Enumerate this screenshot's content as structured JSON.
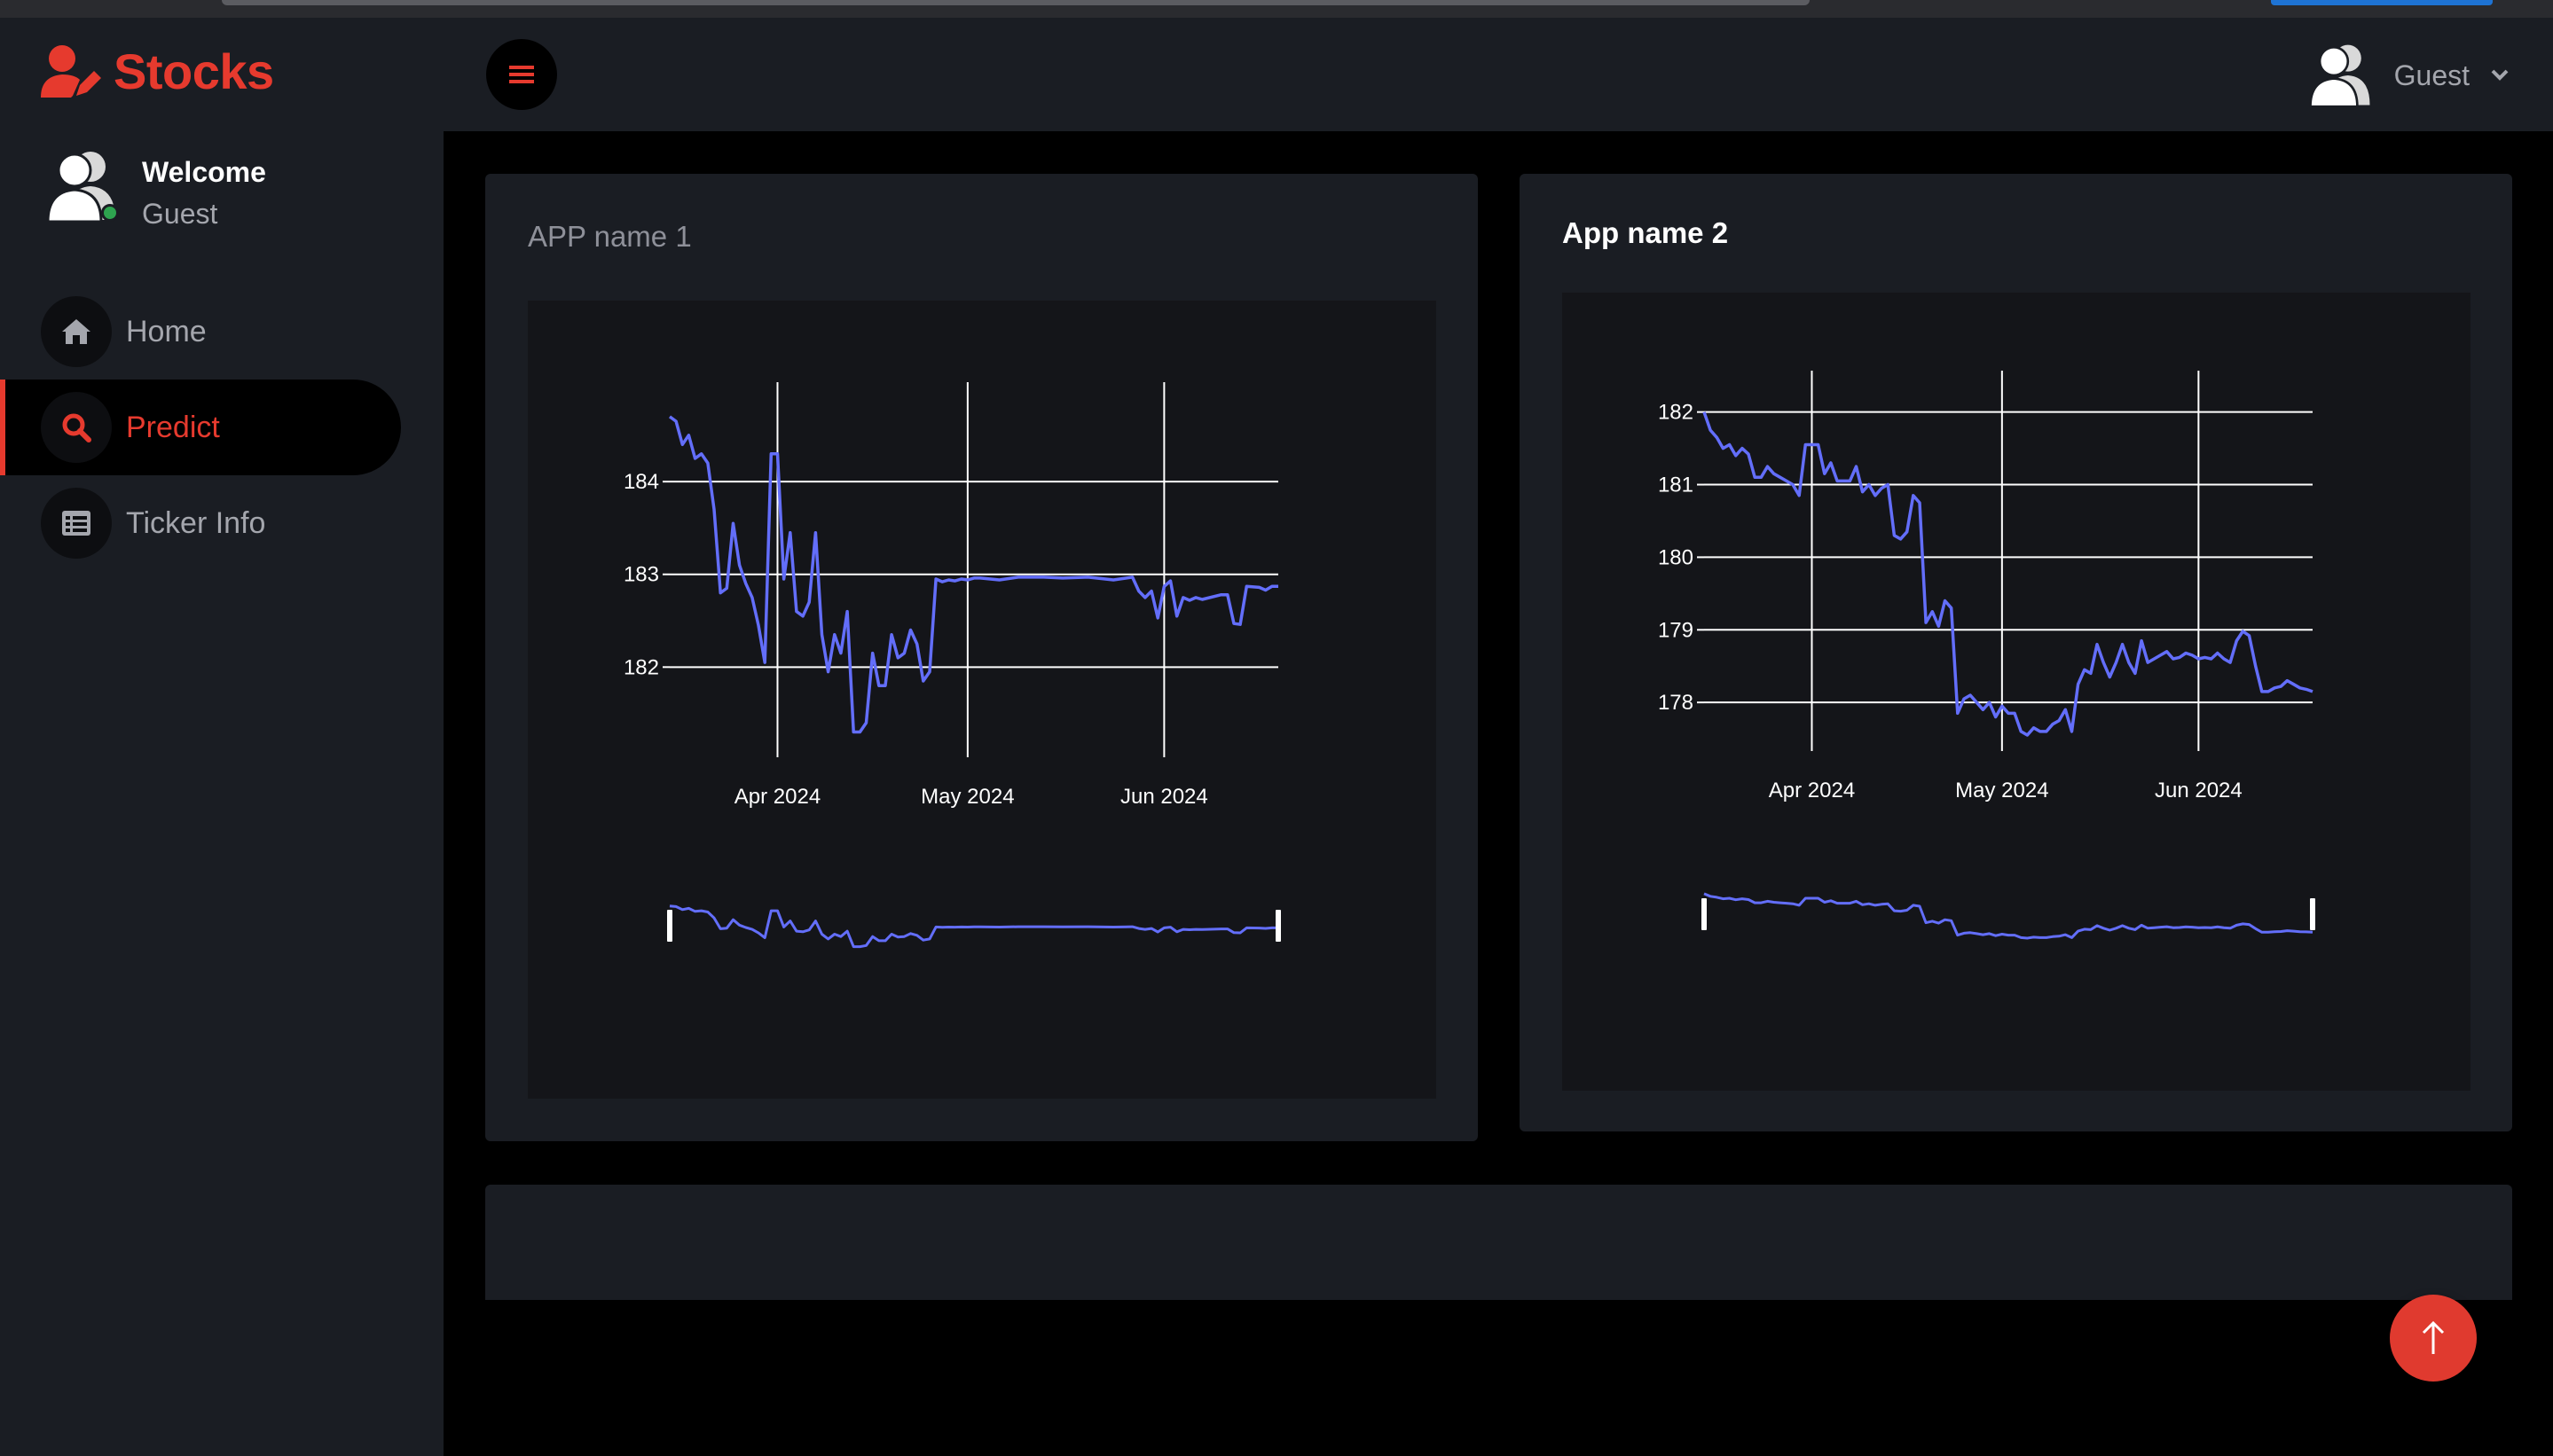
{
  "brand": {
    "name": "Stocks"
  },
  "profile": {
    "welcome": "Welcome",
    "name": "Guest"
  },
  "nav": {
    "items": [
      {
        "label": "Home",
        "icon": "home-icon"
      },
      {
        "label": "Predict",
        "icon": "search-icon",
        "active": true
      },
      {
        "label": "Ticker Info",
        "icon": "list-icon"
      }
    ]
  },
  "header": {
    "user_label": "Guest"
  },
  "cards": [
    {
      "title": "APP name 1"
    },
    {
      "title": "App name 2"
    }
  ],
  "colors": {
    "accent": "#e63a2e",
    "line": "#636efa",
    "sidebar_bg": "#1a1d23",
    "page_bg": "#000000"
  },
  "chart_data": [
    {
      "type": "line",
      "title": "",
      "x_ticks": [
        "Apr 2024",
        "May 2024",
        "Jun 2024"
      ],
      "y_ticks": [
        182,
        183,
        184
      ],
      "ylim": [
        181.2,
        184.9
      ],
      "xlim": [
        "2024-03-15",
        "2024-06-19"
      ],
      "grid": true,
      "range_slider": true,
      "series": [
        {
          "x": [
            "2024-03-15",
            "2024-03-16",
            "2024-03-17",
            "2024-03-18",
            "2024-03-19",
            "2024-03-20",
            "2024-03-21",
            "2024-03-22",
            "2024-03-23",
            "2024-03-24",
            "2024-03-25",
            "2024-03-26",
            "2024-03-27",
            "2024-03-28",
            "2024-03-29",
            "2024-03-30",
            "2024-03-31",
            "2024-04-01",
            "2024-04-02",
            "2024-04-03",
            "2024-04-04",
            "2024-04-05",
            "2024-04-06",
            "2024-04-07",
            "2024-04-08",
            "2024-04-09",
            "2024-04-10",
            "2024-04-11",
            "2024-04-12",
            "2024-04-13",
            "2024-04-14",
            "2024-04-15",
            "2024-04-16",
            "2024-04-17",
            "2024-04-18",
            "2024-04-19",
            "2024-04-20",
            "2024-04-21",
            "2024-04-22",
            "2024-04-23",
            "2024-04-24",
            "2024-04-25",
            "2024-04-26",
            "2024-04-27",
            "2024-04-28",
            "2024-04-29",
            "2024-04-30",
            "2024-05-01",
            "2024-05-02",
            "2024-05-03",
            "2024-05-06",
            "2024-05-09",
            "2024-05-13",
            "2024-05-16",
            "2024-05-20",
            "2024-05-24",
            "2024-05-27",
            "2024-05-28",
            "2024-05-29",
            "2024-05-30",
            "2024-05-31",
            "2024-06-01",
            "2024-06-02",
            "2024-06-03",
            "2024-06-04",
            "2024-06-05",
            "2024-06-06",
            "2024-06-07",
            "2024-06-10",
            "2024-06-11",
            "2024-06-12",
            "2024-06-13",
            "2024-06-14",
            "2024-06-16",
            "2024-06-17",
            "2024-06-18",
            "2024-06-19"
          ],
          "y": [
            184.7,
            184.65,
            184.4,
            184.5,
            184.25,
            184.3,
            184.2,
            183.7,
            182.8,
            182.85,
            183.55,
            183.1,
            182.9,
            182.75,
            182.45,
            182.05,
            184.3,
            184.3,
            182.95,
            183.45,
            182.6,
            182.55,
            182.7,
            183.45,
            182.35,
            181.95,
            182.35,
            182.15,
            182.6,
            181.3,
            181.3,
            181.4,
            182.15,
            181.8,
            181.8,
            182.35,
            182.1,
            182.15,
            182.4,
            182.25,
            181.85,
            181.95,
            182.95,
            182.92,
            182.94,
            182.93,
            182.95,
            182.94,
            182.96,
            182.96,
            182.94,
            182.97,
            182.97,
            182.96,
            182.97,
            182.94,
            182.97,
            182.82,
            182.75,
            182.82,
            182.53,
            182.87,
            182.93,
            182.55,
            182.75,
            182.72,
            182.75,
            182.73,
            182.78,
            182.78,
            182.47,
            182.46,
            182.87,
            182.86,
            182.83,
            182.87,
            182.87
          ]
        }
      ]
    },
    {
      "type": "line",
      "title": "",
      "x_ticks": [
        "Apr 2024",
        "May 2024",
        "Jun 2024"
      ],
      "y_ticks": [
        178,
        179,
        180,
        181,
        182
      ],
      "ylim": [
        177.55,
        182.35
      ],
      "xlim": [
        "2024-03-15",
        "2024-06-19"
      ],
      "grid": true,
      "range_slider": true,
      "series": [
        {
          "x": [
            "2024-03-15",
            "2024-03-16",
            "2024-03-17",
            "2024-03-18",
            "2024-03-19",
            "2024-03-20",
            "2024-03-21",
            "2024-03-22",
            "2024-03-23",
            "2024-03-24",
            "2024-03-25",
            "2024-03-26",
            "2024-03-27",
            "2024-03-28",
            "2024-03-29",
            "2024-03-30",
            "2024-03-31",
            "2024-04-01",
            "2024-04-02",
            "2024-04-03",
            "2024-04-04",
            "2024-04-05",
            "2024-04-06",
            "2024-04-07",
            "2024-04-08",
            "2024-04-09",
            "2024-04-10",
            "2024-04-11",
            "2024-04-12",
            "2024-04-13",
            "2024-04-14",
            "2024-04-15",
            "2024-04-16",
            "2024-04-17",
            "2024-04-18",
            "2024-04-19",
            "2024-04-20",
            "2024-04-21",
            "2024-04-22",
            "2024-04-23",
            "2024-04-24",
            "2024-04-25",
            "2024-04-26",
            "2024-04-27",
            "2024-04-28",
            "2024-04-29",
            "2024-04-30",
            "2024-05-01",
            "2024-05-02",
            "2024-05-03",
            "2024-05-04",
            "2024-05-05",
            "2024-05-06",
            "2024-05-07",
            "2024-05-08",
            "2024-05-09",
            "2024-05-10",
            "2024-05-11",
            "2024-05-12",
            "2024-05-13",
            "2024-05-14",
            "2024-05-15",
            "2024-05-16",
            "2024-05-17",
            "2024-05-18",
            "2024-05-19",
            "2024-05-20",
            "2024-05-21",
            "2024-05-22",
            "2024-05-23",
            "2024-05-24",
            "2024-05-25",
            "2024-05-26",
            "2024-05-27",
            "2024-05-28",
            "2024-05-29",
            "2024-05-30",
            "2024-05-31",
            "2024-06-01",
            "2024-06-02",
            "2024-06-03",
            "2024-06-04",
            "2024-06-05",
            "2024-06-06",
            "2024-06-07",
            "2024-06-08",
            "2024-06-09",
            "2024-06-10",
            "2024-06-11",
            "2024-06-12",
            "2024-06-13",
            "2024-06-14",
            "2024-06-15",
            "2024-06-16",
            "2024-06-17",
            "2024-06-18",
            "2024-06-19"
          ],
          "y": [
            182.0,
            181.75,
            181.65,
            181.5,
            181.55,
            181.4,
            181.5,
            181.42,
            181.1,
            181.1,
            181.25,
            181.15,
            181.1,
            181.05,
            181.0,
            180.85,
            181.55,
            181.55,
            181.55,
            181.15,
            181.3,
            181.05,
            181.05,
            181.05,
            181.25,
            180.9,
            181.0,
            180.85,
            180.95,
            181.0,
            180.3,
            180.25,
            180.35,
            180.85,
            180.75,
            179.1,
            179.25,
            179.05,
            179.4,
            179.3,
            177.85,
            178.05,
            178.1,
            178.0,
            177.9,
            178.0,
            177.8,
            177.95,
            177.85,
            177.85,
            177.6,
            177.55,
            177.65,
            177.6,
            177.6,
            177.7,
            177.75,
            177.9,
            177.6,
            178.25,
            178.45,
            178.4,
            178.8,
            178.55,
            178.35,
            178.55,
            178.8,
            178.55,
            178.4,
            178.85,
            178.55,
            178.6,
            178.65,
            178.7,
            178.6,
            178.62,
            178.68,
            178.65,
            178.6,
            178.62,
            178.6,
            178.68,
            178.6,
            178.55,
            178.85,
            178.98,
            178.92,
            178.5,
            178.15,
            178.15,
            178.2,
            178.22,
            178.3,
            178.25,
            178.2,
            178.18,
            178.15
          ]
        }
      ]
    }
  ]
}
